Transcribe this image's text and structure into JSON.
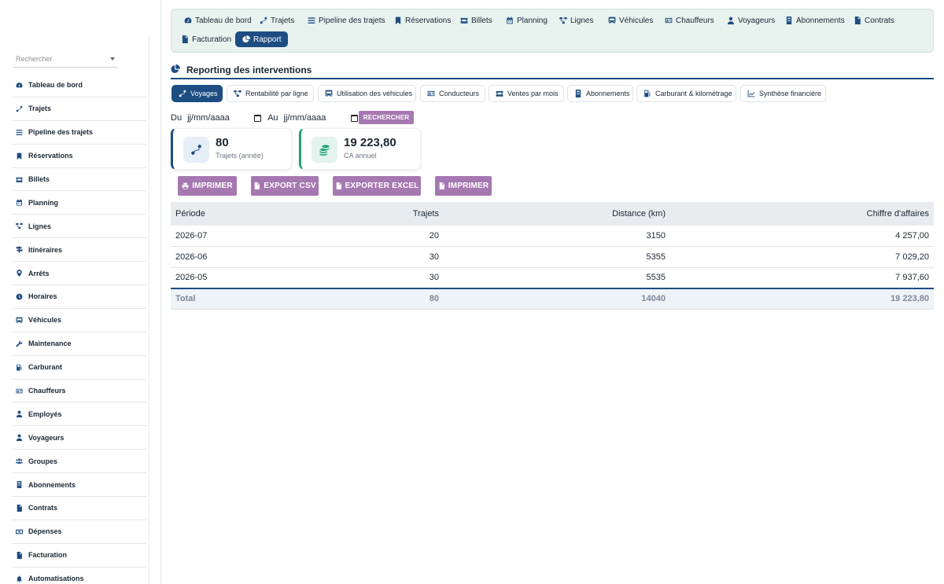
{
  "sidebar": {
    "search_placeholder": "Rechercher",
    "items": [
      {
        "label": "Tableau de bord",
        "icon": "dashboard-icon"
      },
      {
        "label": "Trajets",
        "icon": "route-icon"
      },
      {
        "label": "Pipeline des trajets",
        "icon": "list-icon"
      },
      {
        "label": "Réservations",
        "icon": "bookmark-icon"
      },
      {
        "label": "Billets",
        "icon": "ticket-icon"
      },
      {
        "label": "Planning",
        "icon": "calendar-icon"
      },
      {
        "label": "Lignes",
        "icon": "network-icon"
      },
      {
        "label": "Itinéraires",
        "icon": "signpost-icon"
      },
      {
        "label": "Arrêts",
        "icon": "map-pin-icon"
      },
      {
        "label": "Horaires",
        "icon": "clock-icon"
      },
      {
        "label": "Véhicules",
        "icon": "bus-icon"
      },
      {
        "label": "Maintenance",
        "icon": "wrench-icon"
      },
      {
        "label": "Carburant",
        "icon": "gas-pump-icon"
      },
      {
        "label": "Chauffeurs",
        "icon": "id-card-icon"
      },
      {
        "label": "Employés",
        "icon": "user-tie-icon"
      },
      {
        "label": "Voyageurs",
        "icon": "user-icon"
      },
      {
        "label": "Groupes",
        "icon": "users-icon"
      },
      {
        "label": "Abonnements",
        "icon": "card-icon"
      },
      {
        "label": "Contrats",
        "icon": "file-icon"
      },
      {
        "label": "Dépenses",
        "icon": "money-icon"
      },
      {
        "label": "Facturation",
        "icon": "invoice-icon"
      },
      {
        "label": "Automatisations",
        "icon": "bell-icon"
      }
    ]
  },
  "topnav": {
    "items": [
      {
        "label": "Tableau de bord",
        "icon": "dashboard-icon"
      },
      {
        "label": "Trajets",
        "icon": "route-icon"
      },
      {
        "label": "Pipeline des trajets",
        "icon": "list-icon"
      },
      {
        "label": "Réservations",
        "icon": "bookmark-icon"
      },
      {
        "label": "Billets",
        "icon": "ticket-icon"
      },
      {
        "label": "Planning",
        "icon": "calendar-icon"
      },
      {
        "label": "Lignes",
        "icon": "network-icon"
      },
      {
        "label": "Véhicules",
        "icon": "bus-icon"
      },
      {
        "label": "Chauffeurs",
        "icon": "id-card-icon"
      },
      {
        "label": "Voyageurs",
        "icon": "user-icon"
      },
      {
        "label": "Abonnements",
        "icon": "card-icon"
      },
      {
        "label": "Contrats",
        "icon": "file-icon"
      },
      {
        "label": "Facturation",
        "icon": "invoice-icon"
      },
      {
        "label": "Rapport",
        "icon": "pie-chart-icon",
        "active": true
      }
    ]
  },
  "section": {
    "title": "Reporting des interventions",
    "icon": "pie-chart-icon"
  },
  "report_tabs": [
    {
      "label": "Voyages",
      "icon": "route-icon",
      "active": true
    },
    {
      "label": "Rentabilité par ligne",
      "icon": "network-icon"
    },
    {
      "label": "Utilisation des véhicules",
      "icon": "bus-icon"
    },
    {
      "label": "Conducteurs",
      "icon": "id-card-icon"
    },
    {
      "label": "Ventes par mois",
      "icon": "ticket-icon"
    },
    {
      "label": "Abonnements",
      "icon": "card-icon"
    },
    {
      "label": "Carburant & kilométrage",
      "icon": "gas-pump-icon"
    },
    {
      "label": "Synthèse financière",
      "icon": "line-chart-icon"
    }
  ],
  "filter": {
    "from_label": "Du",
    "from_value": "jj/mm/aaaa",
    "to_label": "Au",
    "to_value": "jj/mm/aaaa",
    "search_button": "RECHERCHER"
  },
  "kpis": [
    {
      "value": "80",
      "label": "Trajets (année)",
      "icon": "route-icon",
      "color": "#1d4d82"
    },
    {
      "value": "19 223,80",
      "label": "CA annuel",
      "icon": "coins-icon",
      "color": "#22a37a"
    }
  ],
  "actions": {
    "print_1": "IMPRIMER",
    "export_csv": "EXPORT CSV",
    "export_excel": "EXPORTER EXCEL",
    "print_2": "IMPRIMER"
  },
  "table": {
    "headers": [
      "Période",
      "Trajets",
      "Distance (km)",
      "Chiffre d'affaires"
    ],
    "rows": [
      [
        "2026-07",
        "20",
        "3150",
        "4 257,00"
      ],
      [
        "2026-06",
        "30",
        "5355",
        "7 029,20"
      ],
      [
        "2026-05",
        "30",
        "5535",
        "7 937,60"
      ]
    ],
    "total": [
      "Total",
      "80",
      "14040",
      "19 223,80"
    ]
  },
  "colors": {
    "primary": "#1d4d82",
    "accent_button": "#a678b2",
    "success": "#22a37a",
    "nav_bg": "#e8f2ef"
  }
}
